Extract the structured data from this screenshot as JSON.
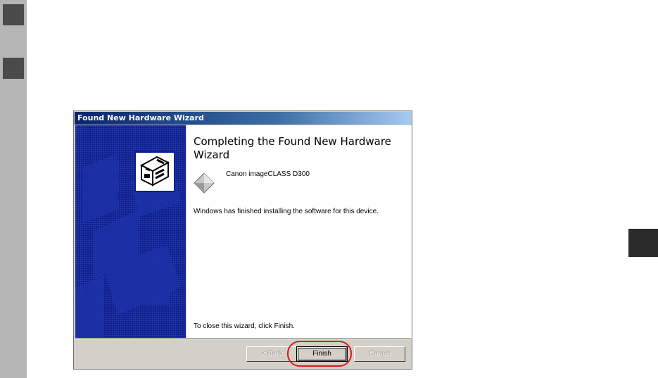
{
  "window": {
    "title": "Found New Hardware Wizard"
  },
  "wizard": {
    "heading": "Completing the Found New Hardware Wizard",
    "device_name": "Canon imageCLASS D300",
    "finished_message": "Windows has finished installing the software for this device.",
    "close_instruction": "To close this wizard, click Finish."
  },
  "buttons": {
    "back_label": "< Back",
    "finish_label": "Finish",
    "cancel_label": "Cancel"
  },
  "icons": {
    "wizard_icon": "hardware-card-icon",
    "device_icon": "device-diamond-icon"
  },
  "colors": {
    "titlebar": "#0a246a",
    "sidebar": "#0c1d86",
    "highlight": "#e0141e",
    "dialog_face": "#d4d0c8"
  }
}
